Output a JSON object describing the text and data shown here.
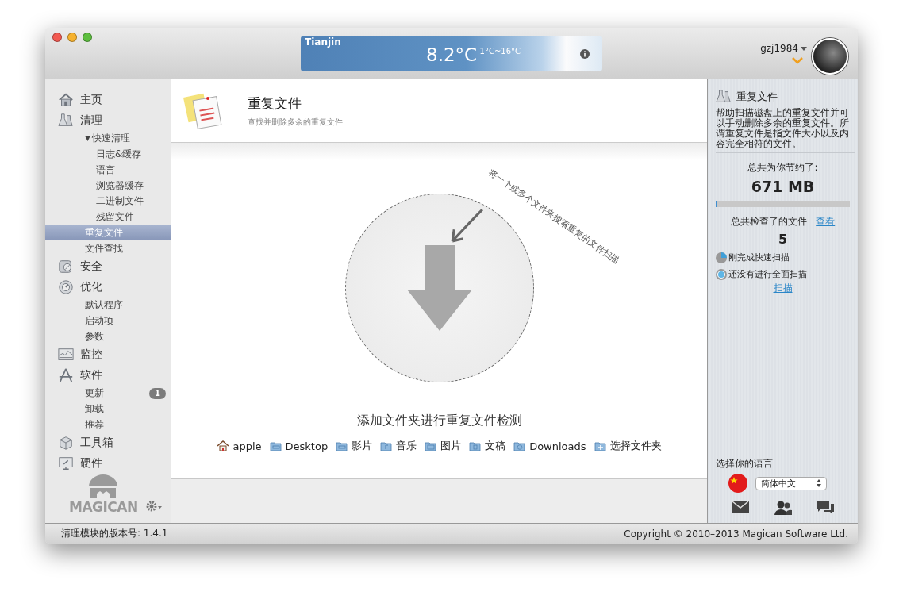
{
  "weather": {
    "city": "Tianjin",
    "temperature": "8.2°C",
    "range": "-1°C~16°C"
  },
  "user": {
    "name": "gzj1984"
  },
  "sidebar": {
    "items": [
      {
        "label": "主页",
        "kind": "home",
        "selected": false
      },
      {
        "label": "清理",
        "kind": "flask",
        "selected": false,
        "children": [
          {
            "label": "快速清理",
            "selected": false,
            "toggle": "▼",
            "expanded": true,
            "children": [
              {
                "label": "日志&缓存",
                "selected": false
              },
              {
                "label": "语言",
                "selected": false
              },
              {
                "label": "浏览器缓存",
                "selected": false
              },
              {
                "label": "二进制文件",
                "selected": false
              },
              {
                "label": "残留文件",
                "selected": false
              }
            ]
          },
          {
            "label": "重复文件",
            "selected": true
          },
          {
            "label": "文件查找",
            "selected": false
          }
        ]
      },
      {
        "label": "安全",
        "kind": "safe",
        "selected": false
      },
      {
        "label": "优化",
        "kind": "gauge",
        "selected": false,
        "children": [
          {
            "label": "默认程序",
            "selected": false
          },
          {
            "label": "启动项",
            "selected": false
          },
          {
            "label": "参数",
            "selected": false
          }
        ]
      },
      {
        "label": "监控",
        "kind": "monitor",
        "selected": false
      },
      {
        "label": "软件",
        "kind": "apps",
        "selected": false,
        "children": [
          {
            "label": "更新",
            "selected": false,
            "badge": "1"
          },
          {
            "label": "卸载",
            "selected": false
          },
          {
            "label": "推荐",
            "selected": false
          }
        ]
      },
      {
        "label": "工具箱",
        "kind": "toolbox",
        "selected": false
      },
      {
        "label": "硬件",
        "kind": "hardware",
        "selected": false
      }
    ],
    "logo": "MAGICAN"
  },
  "main": {
    "header": {
      "title": "重复文件",
      "subtitle": "查找并删除多余的重复文件"
    },
    "drop_hint": "将一个或多个文件夹搜索重复的文件扫描",
    "caption": "添加文件夹进行重复文件检测",
    "folders": [
      {
        "label": "apple",
        "kind": "home"
      },
      {
        "label": "Desktop",
        "kind": "folder"
      },
      {
        "label": "影片",
        "kind": "folder"
      },
      {
        "label": "音乐",
        "kind": "music"
      },
      {
        "label": "图片",
        "kind": "picture"
      },
      {
        "label": "文稿",
        "kind": "document"
      },
      {
        "label": "Downloads",
        "kind": "download"
      },
      {
        "label": "选择文件夹",
        "kind": "add"
      }
    ]
  },
  "info_panel": {
    "title": "重复文件",
    "description": "帮助扫描磁盘上的重复文件并可以手动删除多余的重复文件。所谓重复文件是指文件大小以及内容完全相符的文件。",
    "saved_label": "总共为你节约了:",
    "saved_value": "671 MB",
    "progress": {
      "level": 0.01
    },
    "checked_label": "总共检查了的文件",
    "view_link": "查看",
    "checked_count": "5",
    "scans": [
      {
        "label": "刚完成快速扫描",
        "kind": "pie"
      },
      {
        "label": "还没有进行全面扫描",
        "kind": "dot"
      }
    ],
    "scan_link": "扫描",
    "language": {
      "label": "选择你的语言",
      "value": "简体中文"
    }
  },
  "status_bar": {
    "version": "清理模块的版本号: 1.4.1",
    "copyright": "Copyright © 2010–2013 Magican Software Ltd."
  }
}
